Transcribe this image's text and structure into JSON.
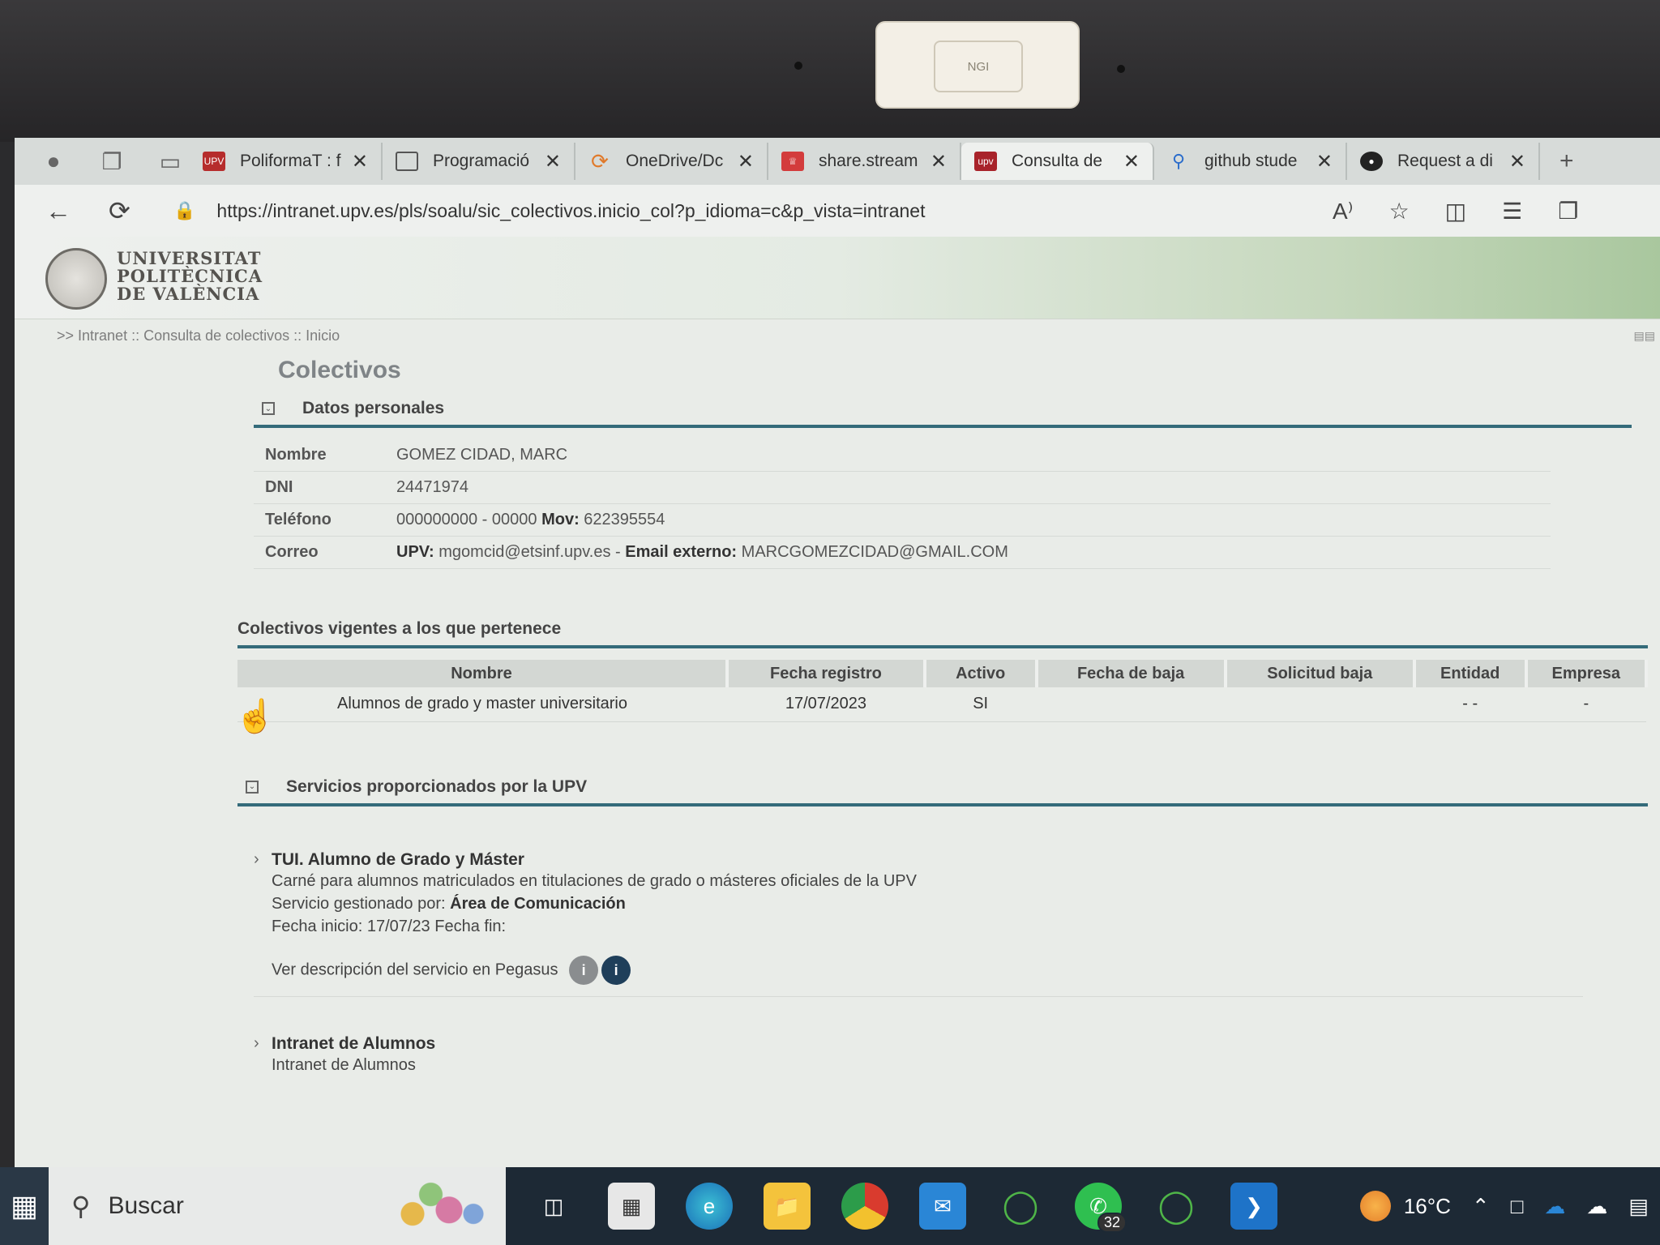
{
  "webcam": {
    "label": "NGI"
  },
  "tabs": [
    {
      "title": "PoliformaT : f",
      "favicon": "UPV",
      "color": "#b62c2c"
    },
    {
      "title": "Programació",
      "favicon": "doc",
      "color": "#6b6b6b"
    },
    {
      "title": "OneDrive/Dc",
      "favicon": "spin",
      "color": "#e07a2b"
    },
    {
      "title": "share.stream",
      "favicon": "crown",
      "color": "#d33c3c"
    },
    {
      "title": "Consulta de",
      "favicon": "upv",
      "color": "#a8232a",
      "active": true
    },
    {
      "title": "github stude",
      "favicon": "search",
      "color": "#2a6ccb"
    },
    {
      "title": "Request a di",
      "favicon": "github",
      "color": "#222222"
    }
  ],
  "address_bar": {
    "url": "https://intranet.upv.es/pls/soalu/sic_colectivos.inicio_col?p_idioma=c&p_vista=intranet",
    "read_aloud": "A⁾"
  },
  "header": {
    "university_line1": "UNIVERSITAT",
    "university_line2": "POLITÈCNICA",
    "university_line3": "DE VALÈNCIA"
  },
  "breadcrumb": ">> Intranet :: Consulta de colectivos :: Inicio",
  "page_title": "Colectivos",
  "datos_personales": {
    "title": "Datos personales",
    "rows": [
      {
        "label": "Nombre",
        "value": "GOMEZ CIDAD, MARC"
      },
      {
        "label": "DNI",
        "value": "24471974"
      },
      {
        "label": "Teléfono",
        "value": "000000000 - 00000",
        "extra_label": "Mov:",
        "extra_value": "622395554"
      },
      {
        "label": "Correo",
        "pre_label": "UPV:",
        "value": "mgomcid@etsinf.upv.es -",
        "extra_label": "Email externo:",
        "extra_value": "MARCGOMEZCIDAD@GMAIL.COM"
      }
    ]
  },
  "colectivos": {
    "title": "Colectivos vigentes a los que pertenece",
    "columns": [
      "Nombre",
      "Fecha registro",
      "Activo",
      "Fecha de baja",
      "Solicitud baja",
      "Entidad",
      "Empresa"
    ],
    "rows": [
      [
        "Alumnos de grado y master universitario",
        "17/07/2023",
        "SI",
        "",
        "",
        "- -",
        "-"
      ]
    ]
  },
  "servicios": {
    "title": "Servicios proporcionados por la UPV",
    "items": [
      {
        "title": "TUI. Alumno de Grado y Máster",
        "description": "Carné para alumnos matriculados en titulaciones de grado o másteres oficiales de la UPV",
        "managed_label": "Servicio gestionado por:",
        "managed_by": "Área de Comunicación",
        "dates": "Fecha inicio: 17/07/23 Fecha fin:",
        "pegasus_link": "Ver descripción del servicio en Pegasus"
      },
      {
        "title": "Intranet de Alumnos",
        "description": "Intranet de Alumnos"
      }
    ]
  },
  "taskbar": {
    "search_label": "Buscar",
    "whatsapp_badge": "32",
    "weather_temp": "16°C"
  }
}
